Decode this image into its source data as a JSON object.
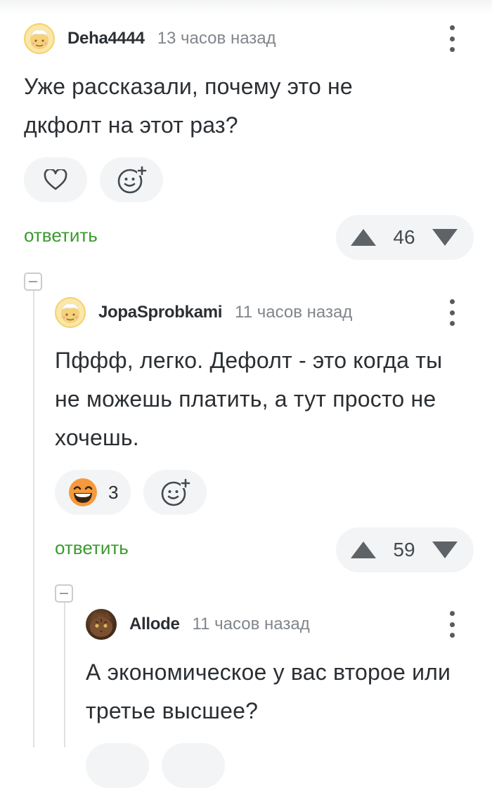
{
  "comments": [
    {
      "username": "Deha4444",
      "time": "13 часов назад",
      "text": "Уже рассказали, почему это не дкфолт на этот раз?",
      "reply_label": "ответить",
      "rating": "46"
    },
    {
      "username": "JopaSprobkami",
      "time": "11 часов назад",
      "text": "Пффф, легко. Дефолт - это когда ты не можешь платить, а тут просто не хочешь.",
      "reaction_count": "3",
      "reply_label": "ответить",
      "rating": "59"
    },
    {
      "username": "Allode",
      "time": "11 часов назад",
      "text": "А экономическое у вас второе или третье высшее?"
    }
  ],
  "icons": {
    "heart": "heart-icon",
    "add_reaction": "add-reaction-icon",
    "grin_emoji": "grinning-emoji-icon",
    "upvote": "upvote-icon",
    "downvote": "downvote-icon",
    "more": "more-vertical-icon",
    "collapse": "collapse-thread-icon"
  },
  "colors": {
    "reply_green": "#3b9a2e",
    "pill_bg": "#f3f4f5",
    "emoji_orange": "#f59a3c"
  }
}
